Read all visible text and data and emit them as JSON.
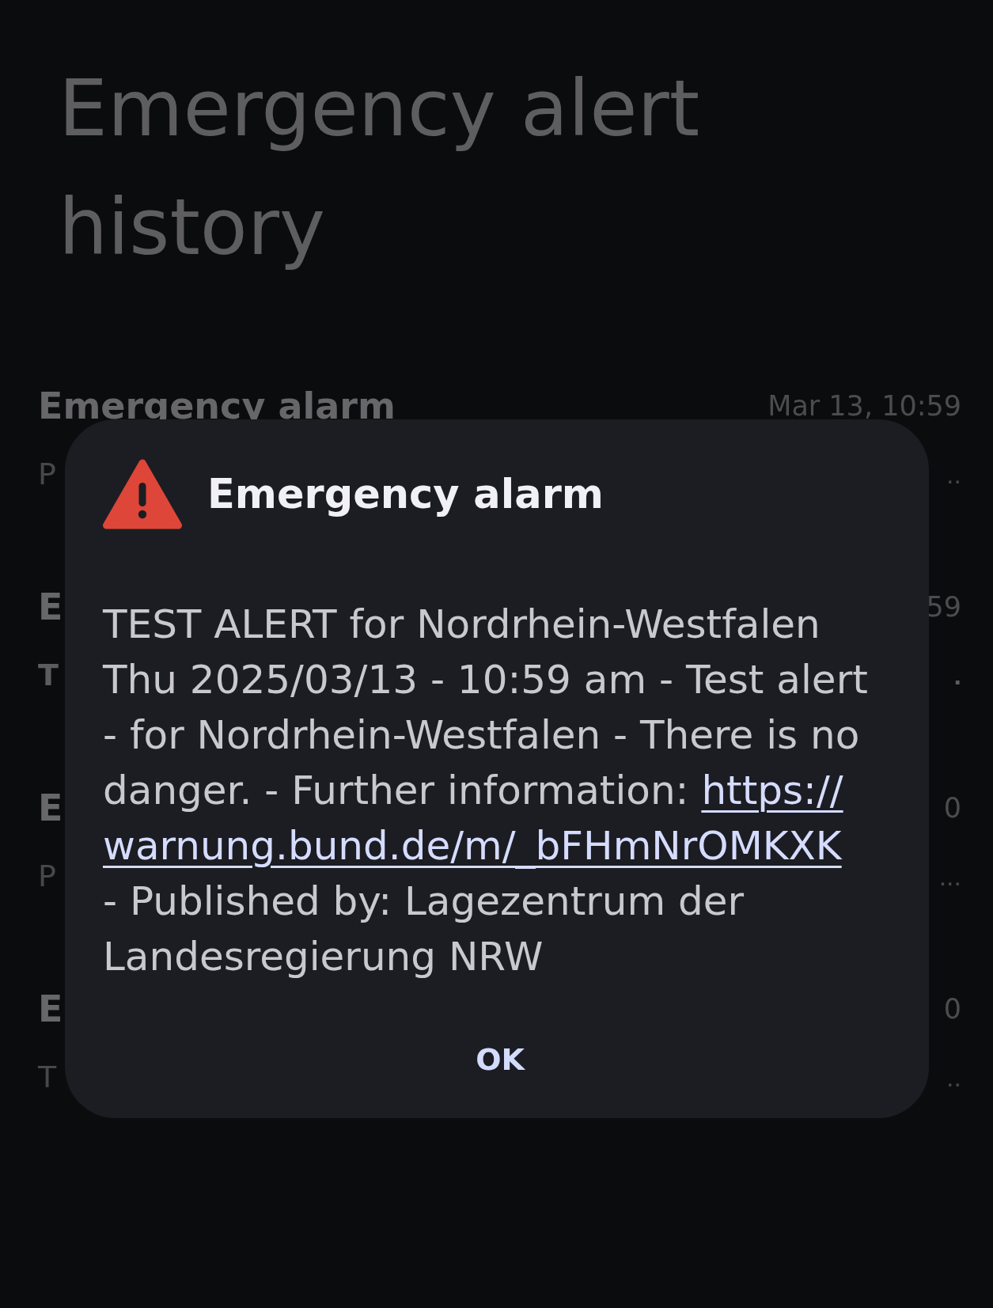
{
  "page_title": "Emergency alert history",
  "history": [
    {
      "title": "Emergency alarm",
      "time": "Mar 13, 10:59",
      "preview_start": "P",
      "preview_end": "..",
      "unread": false
    },
    {
      "title": "E",
      "time": "59",
      "preview_start": "T",
      "preview_end": ".",
      "unread": true
    },
    {
      "title": "E",
      "time": "0",
      "preview_start": "P",
      "preview_end": "...",
      "unread": false
    },
    {
      "title": "E",
      "time": "0",
      "preview_start": "T",
      "preview_end": "..",
      "unread": false
    }
  ],
  "dialog": {
    "title": "Emergency alarm",
    "message_lines": [
      [
        {
          "kind": "text",
          "text": "TEST ALERT for Nordrhein-Westfalen"
        }
      ],
      [
        {
          "kind": "text",
          "text": "Thu 2025/03/13 - 10:59 am - Test alert"
        }
      ],
      [
        {
          "kind": "text",
          "text": "- for Nordrhein-Westfalen - There is no"
        }
      ],
      [
        {
          "kind": "text",
          "text": "danger. - Further information:"
        },
        {
          "kind": "link",
          "text": "https://"
        }
      ],
      [
        {
          "kind": "link",
          "text": "warnung.bund.de/m/_bFHmNrOMKXK"
        }
      ],
      [
        {
          "kind": "text",
          "text": "- Published by: Lagezentrum der"
        }
      ],
      [
        {
          "kind": "text",
          "text": "Landesregierung NRW"
        }
      ]
    ],
    "button": "OK"
  }
}
